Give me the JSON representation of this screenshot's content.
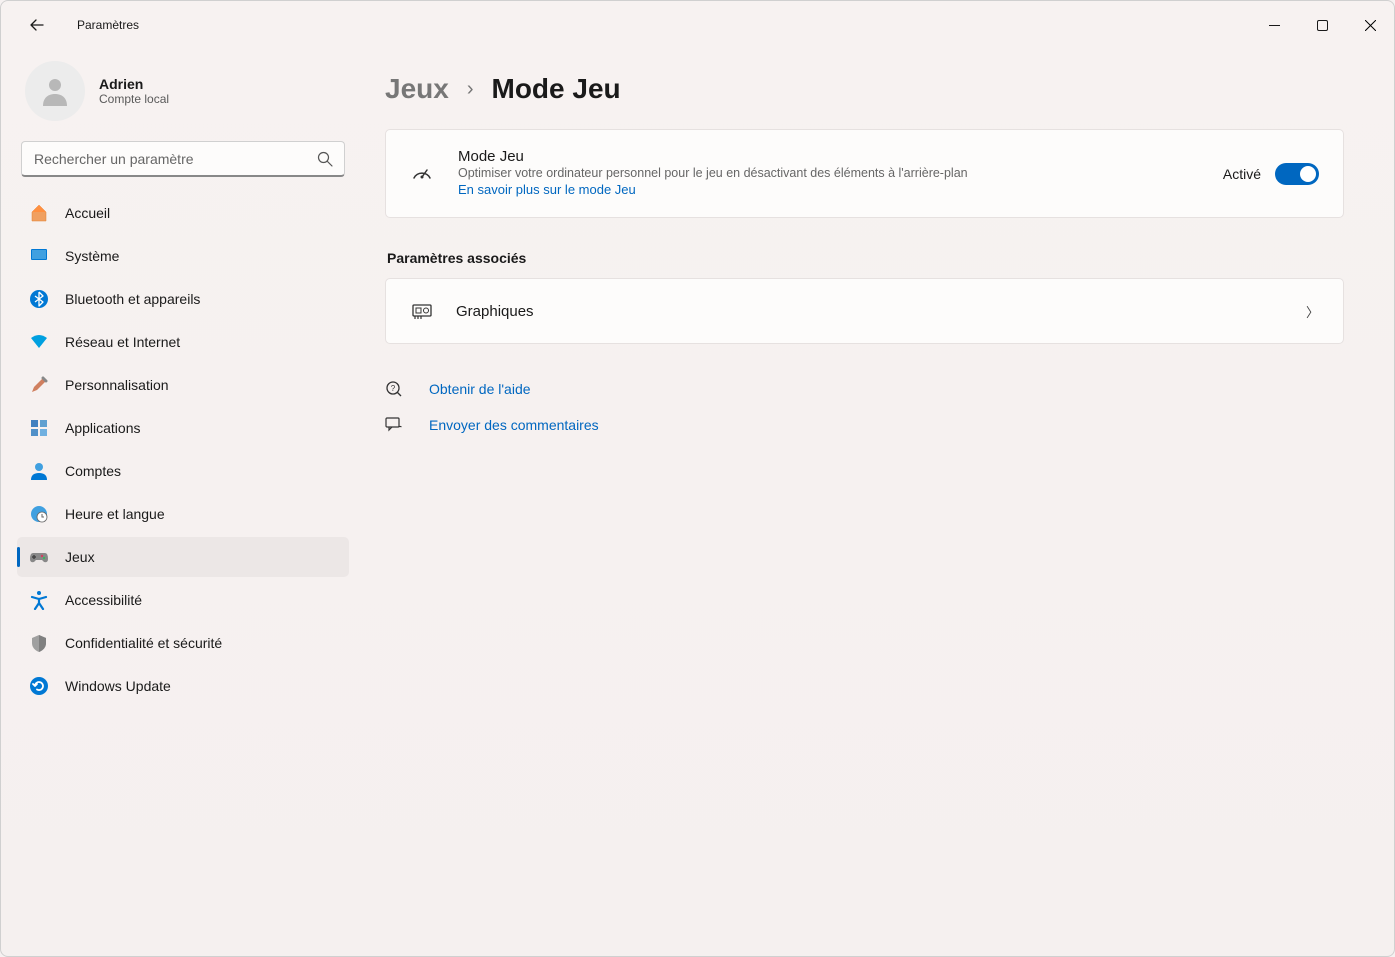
{
  "app": {
    "title": "Paramètres"
  },
  "user": {
    "name": "Adrien",
    "subtitle": "Compte local"
  },
  "search": {
    "placeholder": "Rechercher un paramètre"
  },
  "nav": {
    "home": "Accueil",
    "system": "Système",
    "bluetooth": "Bluetooth et appareils",
    "network": "Réseau et Internet",
    "personalization": "Personnalisation",
    "apps": "Applications",
    "accounts": "Comptes",
    "time": "Heure et langue",
    "gaming": "Jeux",
    "accessibility": "Accessibilité",
    "privacy": "Confidentialité et sécurité",
    "update": "Windows Update"
  },
  "breadcrumb": {
    "parent": "Jeux",
    "current": "Mode Jeu"
  },
  "gameMode": {
    "title": "Mode Jeu",
    "desc": "Optimiser votre ordinateur personnel pour le jeu en désactivant des éléments à l'arrière-plan",
    "learnMore": "En savoir plus sur le mode Jeu",
    "state": "Activé"
  },
  "related": {
    "header": "Paramètres associés",
    "graphics": "Graphiques"
  },
  "help": {
    "getHelp": "Obtenir de l'aide",
    "feedback": "Envoyer des commentaires"
  }
}
